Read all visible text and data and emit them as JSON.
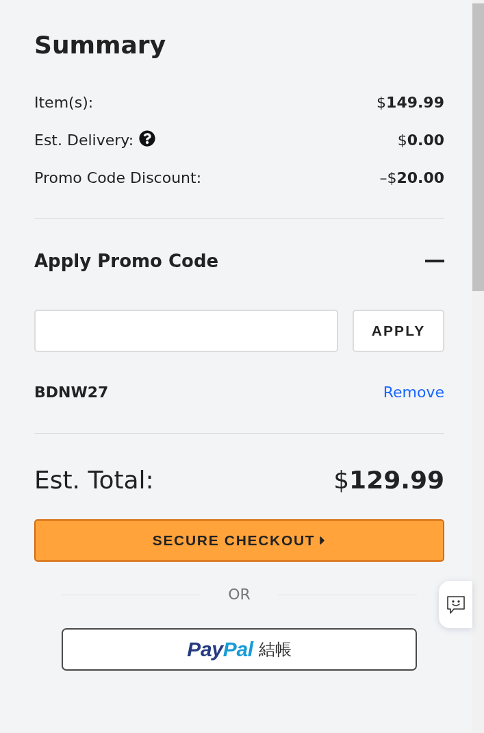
{
  "summary": {
    "title": "Summary",
    "rows": [
      {
        "label": "Item(s):",
        "value": "$**149.99**",
        "help": false
      },
      {
        "label": "Est. Delivery:",
        "value": "$**0.00**",
        "help": true
      },
      {
        "label": "Promo Code Discount:",
        "value": "–$**20.00**",
        "help": false
      }
    ]
  },
  "promo": {
    "title": "Apply Promo Code",
    "expanded": true,
    "apply_button": "APPLY",
    "applied_code": "BDNW27",
    "remove_link": "Remove"
  },
  "total": {
    "label": "Est. Total:",
    "value": "$**129.99**"
  },
  "checkout_button": "SECURE CHECKOUT",
  "separator_text": "OR",
  "paypal_button": {
    "logo": [
      {
        "text": "Pay",
        "color": "#253b80"
      },
      {
        "text": "Pal",
        "color": "#179bd7"
      }
    ],
    "label": "結帳"
  }
}
